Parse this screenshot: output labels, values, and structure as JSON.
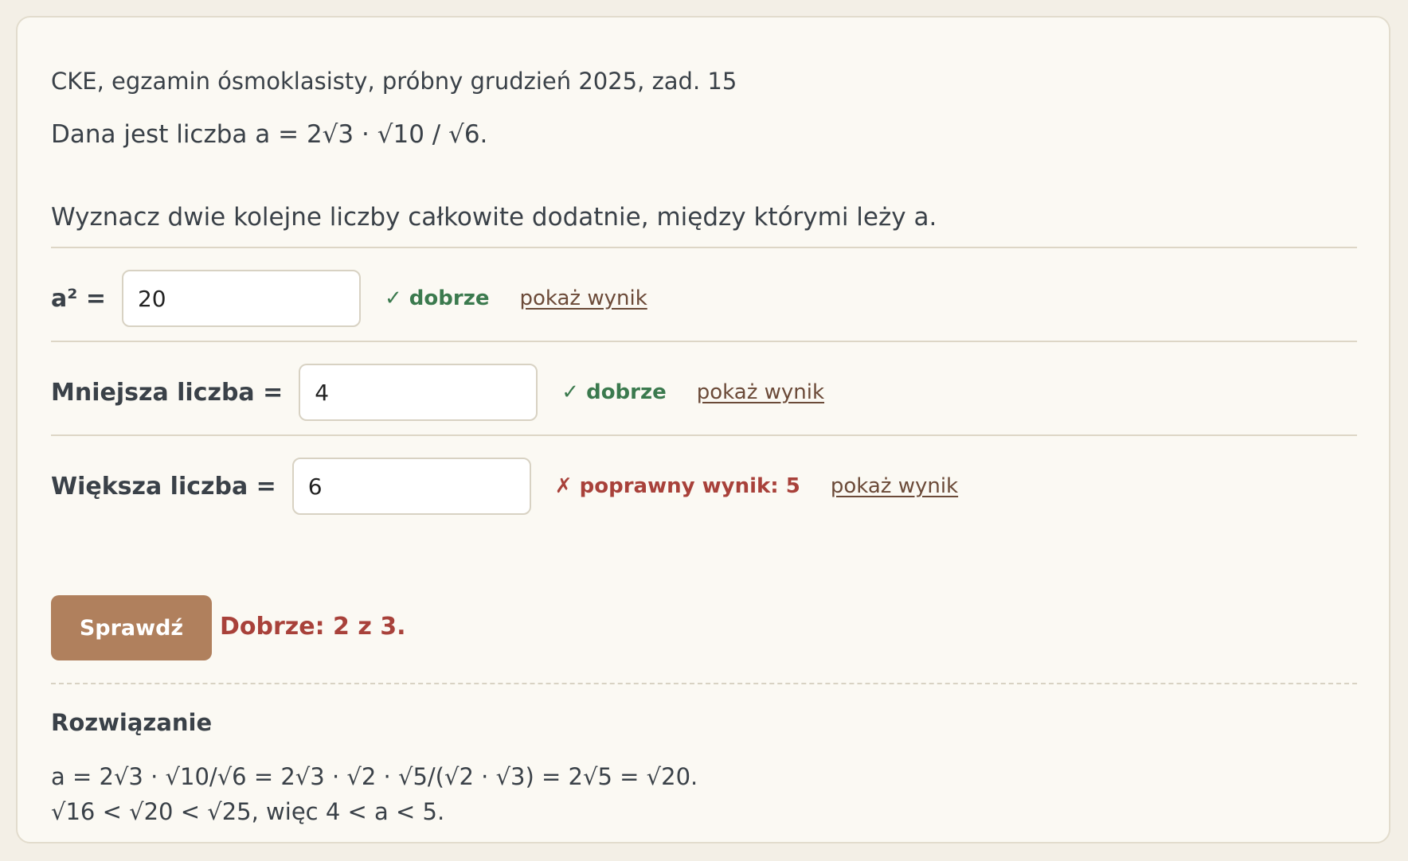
{
  "problem": {
    "source": "CKE, egzamin ósmoklasisty, próbny grudzień 2025, zad. 15",
    "statement": "Dana jest liczba a = 2√3 · √10 / √6.",
    "task": "Wyznacz dwie kolejne liczby całkowite dodatnie, między którymi leży a."
  },
  "answers": [
    {
      "label": "a² =",
      "value": "20",
      "status": "correct",
      "feedback": "✓ dobrze",
      "link": "pokaż wynik"
    },
    {
      "label": "Mniejsza liczba =",
      "value": "4",
      "status": "correct",
      "feedback": "✓ dobrze",
      "link": "pokaż wynik"
    },
    {
      "label": "Większa liczba =",
      "value": "6",
      "status": "incorrect",
      "feedback": "✗ poprawny wynik: 5",
      "link": "pokaż wynik"
    }
  ],
  "check": {
    "button_label": "Sprawdź",
    "score_text": "Dobrze: 2 z 3."
  },
  "solution": {
    "title": "Rozwiązanie",
    "lines": [
      "a = 2√3 · √10/√6 = 2√3 · √2 · √5/(√2 · √3) = 2√5 = √20.",
      "√16 < √20 < √25, więc 4 < a < 5."
    ]
  },
  "colors": {
    "page_background": "#f3efe6",
    "card_background": "#fbf9f3",
    "correct": "#3b7a4e",
    "incorrect": "#a8413a",
    "button": "#b0805d",
    "link": "#6b4a38"
  }
}
